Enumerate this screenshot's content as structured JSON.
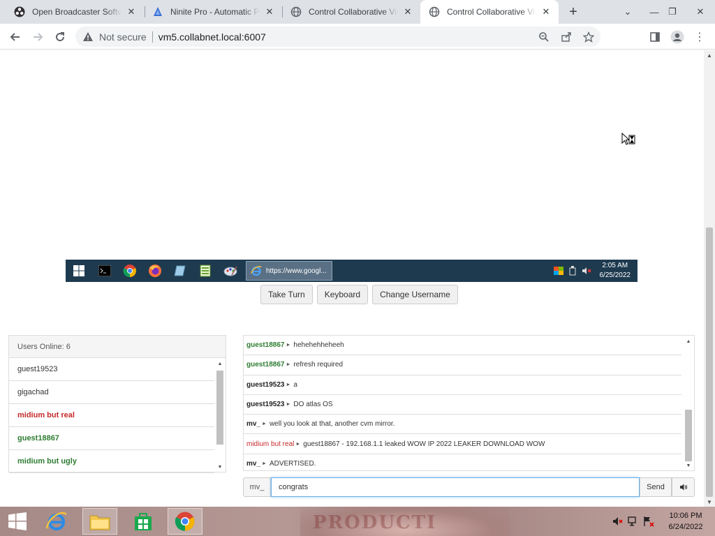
{
  "browser": {
    "tabs": [
      {
        "title": "Open Broadcaster Software",
        "icon": "obs-icon"
      },
      {
        "title": "Ninite Pro - Automatic Patch",
        "icon": "ninite-icon"
      },
      {
        "title": "Control Collaborative Virtual",
        "icon": "globe-icon"
      },
      {
        "title": "Control Collaborative Virtual",
        "icon": "globe-icon",
        "active": true
      }
    ],
    "security_label": "Not secure",
    "url": "vm5.collabnet.local:6007"
  },
  "vm": {
    "taskbar": {
      "ie_task_label": "https://www.googl...",
      "clock_time": "2:05 AM",
      "clock_date": "6/25/2022"
    },
    "buttons": {
      "take_turn": "Take Turn",
      "keyboard": "Keyboard",
      "change_username": "Change Username"
    }
  },
  "users_panel": {
    "header": "Users Online: 6",
    "users": [
      {
        "name": "guest19523",
        "color": "#333333"
      },
      {
        "name": "gigachad",
        "color": "#333333"
      },
      {
        "name": "midium but real",
        "color": "#c62828"
      },
      {
        "name": "guest18867",
        "color": "#2e7d32"
      },
      {
        "name": "midium but ugly",
        "color": "#2e7d32"
      }
    ]
  },
  "chat": {
    "messages": [
      {
        "user": "guest18867",
        "text": "hehehehheheeh",
        "style": "green"
      },
      {
        "user": "guest18867",
        "text": "refresh required",
        "style": "green"
      },
      {
        "user": "guest19523",
        "text": "a",
        "style": "dark"
      },
      {
        "user": "guest19523",
        "text": "DO atlas OS",
        "style": "dark"
      },
      {
        "user": "mv_",
        "text": "well you look at that, another cvm mirror.",
        "style": "dark"
      },
      {
        "user": "midium but real",
        "text": "guest18867 - 192.168.1.1 leaked WOW IP 2022 LEAKER DOWNLOAD WOW",
        "style": "red"
      },
      {
        "user": "mv_",
        "text": "ADVERTISED.",
        "style": "dark"
      }
    ],
    "username": "mv_",
    "input_value": "congrats",
    "send_label": "Send"
  },
  "host_taskbar": {
    "clock_time": "10:06 PM",
    "clock_date": "6/24/2022",
    "wallpaper_text": "PRODUCTI"
  }
}
